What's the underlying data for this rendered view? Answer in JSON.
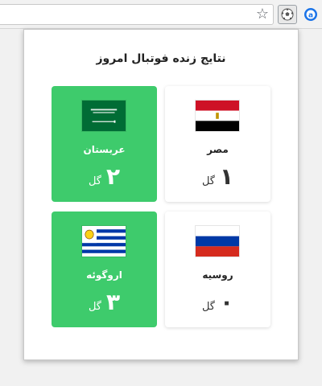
{
  "browser": {
    "star_icon": "star-icon",
    "extension_icon": "football-icon",
    "extension2_icon": "circle-a-icon"
  },
  "popup": {
    "title": "نتایج زنده فوتبال امروز",
    "goal_unit": "گل",
    "matches": [
      {
        "home": {
          "name": "مصر",
          "score": "۱",
          "flag": "egypt-flag",
          "highlight": false
        },
        "away": {
          "name": "عربستان",
          "score": "۲",
          "flag": "saudi-arabia-flag",
          "highlight": true
        }
      },
      {
        "home": {
          "name": "روسیه",
          "score": "۰",
          "flag": "russia-flag",
          "highlight": false
        },
        "away": {
          "name": "اروگوئه",
          "score": "۳",
          "flag": "uruguay-flag",
          "highlight": true
        }
      }
    ]
  },
  "colors": {
    "winner_bg": "#3ecb6c",
    "card_bg": "#ffffff"
  }
}
